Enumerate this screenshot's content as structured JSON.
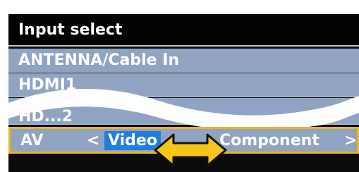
{
  "menu": {
    "title": "Input select",
    "items": [
      {
        "label": "ANTENNA/Cable In"
      },
      {
        "label": "HDMI1"
      },
      {
        "label": "HD...2"
      }
    ],
    "selected_row": {
      "label": "AV",
      "arrow_left": "<",
      "current_option": "Video",
      "next_option": "Component",
      "arrow_right": ">"
    }
  },
  "annotation": {
    "swap_icon": "double-headed-arrow-icon",
    "color": "#f5c518"
  },
  "colors": {
    "menu_row": "#8fa3c2",
    "title_bar": "#030303",
    "highlight_border": "#f2b418",
    "selected_option": "#1f7fe0"
  }
}
